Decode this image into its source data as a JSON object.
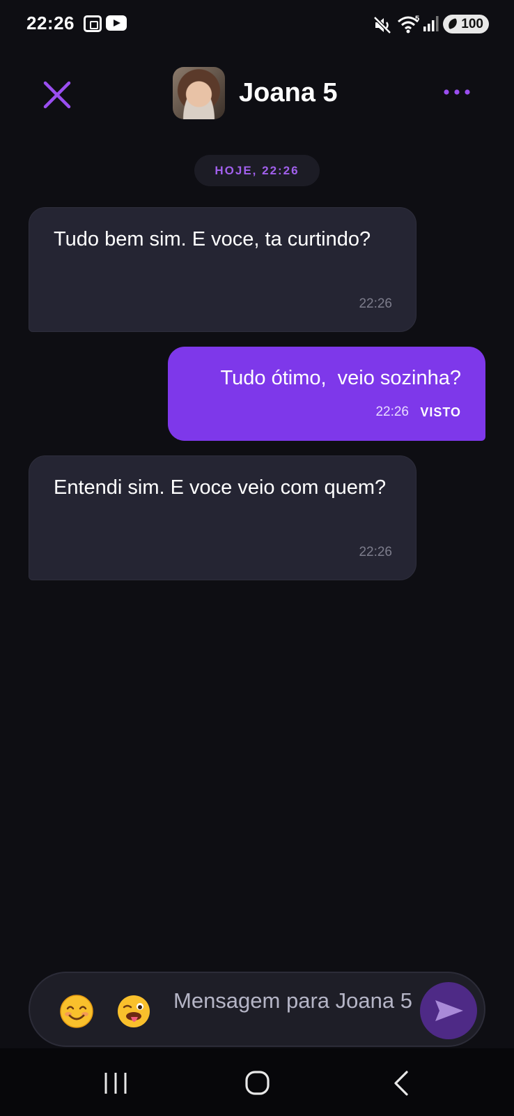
{
  "status_bar": {
    "time": "22:26",
    "battery": "100",
    "wifi_badge": "5",
    "icons": [
      "screenshot-icon",
      "youtube-icon",
      "mute-icon",
      "wifi-icon",
      "signal-icon",
      "battery-icon"
    ]
  },
  "header": {
    "contact_name": "Joana 5",
    "close_icon": "close-icon",
    "more_icon": "more-horizontal-icon",
    "accent_color": "#9a4ef0"
  },
  "date_chip": "HOJE, 22:26",
  "messages": [
    {
      "direction": "in",
      "text": "Tudo bem sim. E voce, ta curtindo?",
      "time": "22:26"
    },
    {
      "direction": "out",
      "text": "Tudo ótimo,  veio sozinha?",
      "time": "22:26",
      "status": "VISTO"
    },
    {
      "direction": "in",
      "text": "Entendi sim. E voce veio com quem?",
      "time": "22:26"
    }
  ],
  "composer": {
    "placeholder": "Mensagem para Joana 5",
    "emoji_1": "smiling-face-emoji",
    "emoji_2": "winking-tongue-emoji",
    "send_icon": "send-icon"
  },
  "nav": {
    "recents_icon": "recents-icon",
    "home_icon": "home-icon",
    "back_icon": "back-icon"
  },
  "colors": {
    "background": "#0e0e13",
    "incoming_bubble": "#252533",
    "outgoing_bubble": "#7e38ea",
    "accent": "#9a4ef0"
  }
}
